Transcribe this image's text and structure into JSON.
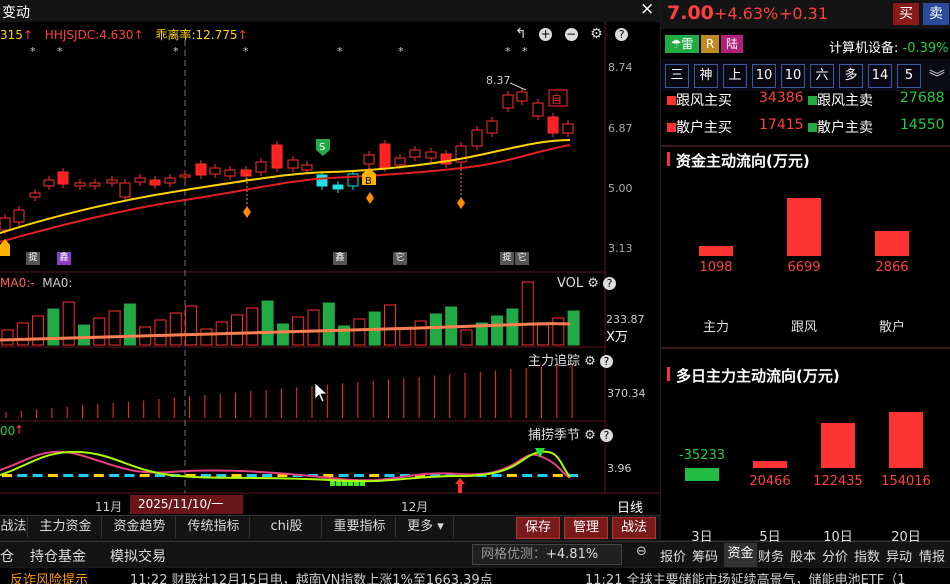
{
  "header": {
    "title": "变动",
    "close": "×"
  },
  "indicator_line": {
    "prefix": "315",
    "hhsjdc": "HHJSJDC:4.630",
    "deviation": "乖离率:12.775",
    "arrow": "↑"
  },
  "price_axis": [
    "8.74",
    "6.87",
    "5.00",
    "3.13"
  ],
  "annotations": {
    "high": "8.37",
    "box": "自",
    "left_badges": [
      "提",
      "鑫",
      "鑫",
      "它",
      "提",
      "它"
    ]
  },
  "volume_panel": {
    "ma_label": "MA0:-",
    "ma_label2": "MA0:",
    "title": "VOL",
    "value": "233.87",
    "unit": "X万"
  },
  "main_force_panel": {
    "title": "主力追踪",
    "value": "370.34"
  },
  "season_panel": {
    "title": "捕捞季节",
    "prefix": "00",
    "value": "3.96"
  },
  "time_axis": {
    "nov": "11月",
    "cursor_date": "2025/11/10/一",
    "dec": "12月",
    "period": "日线"
  },
  "bottom_tabs": [
    "战法",
    "主力资金",
    "资金趋势",
    "传统指标",
    "chi股",
    "重要指标",
    "更多 ▾"
  ],
  "bottom_actions": [
    "保存",
    "管理",
    "战法"
  ],
  "status_bar": {
    "items": [
      "仓",
      "持仓基金",
      "模拟交易"
    ],
    "optimize_label": "网格优测：",
    "optimize_value": "+4.81%"
  },
  "right_tabs": [
    "报价",
    "筹码",
    "资金",
    "财务",
    "股本",
    "分价",
    "指数",
    "异动",
    "情报"
  ],
  "ticker": {
    "left": "反诈风险提示",
    "news1": "11:22 财联社12月15日电，越南VN指数上涨1%至1663.39点",
    "news2": "11:21 全球主要储能市场延续高景气，储能电池ETF（1"
  },
  "quote": {
    "price": "7.00",
    "pct": "+4.63%",
    "change": "+0.31",
    "buy": "买",
    "sell": "卖"
  },
  "badges": {
    "thunder": "雷",
    "r": "R",
    "lu": "陆"
  },
  "sector": {
    "name": "计算机设备:",
    "pct": "-0.39%"
  },
  "period_tabs": [
    "三",
    "神",
    "上",
    "10",
    "10",
    "六",
    "多",
    "14",
    "5"
  ],
  "trade_stats": [
    {
      "l_label": "跟风主买",
      "l_value": "34386",
      "r_label": "跟风主卖",
      "r_value": "27688"
    },
    {
      "l_label": "散户主买",
      "l_value": "17415",
      "r_label": "散户主卖",
      "r_value": "14550"
    }
  ],
  "capital_flow": {
    "title": "资金主动流向(万元)",
    "bars": [
      {
        "label": "主力",
        "value": "1098",
        "v": 1098
      },
      {
        "label": "跟风",
        "value": "6699",
        "v": 6699
      },
      {
        "label": "散户",
        "value": "2866",
        "v": 2866
      }
    ]
  },
  "multiday_flow": {
    "title": "多日主力主动流向(万元)",
    "bars": [
      {
        "label": "3日",
        "value": "-35233",
        "v": -35233
      },
      {
        "label": "5日",
        "value": "20466",
        "v": 20466
      },
      {
        "label": "10日",
        "value": "122435",
        "v": 122435
      },
      {
        "label": "20日",
        "value": "154016",
        "v": 154016
      }
    ]
  },
  "colors": {
    "up": "#ff3030",
    "down": "#22aa44",
    "accent": "#ffd400"
  }
}
